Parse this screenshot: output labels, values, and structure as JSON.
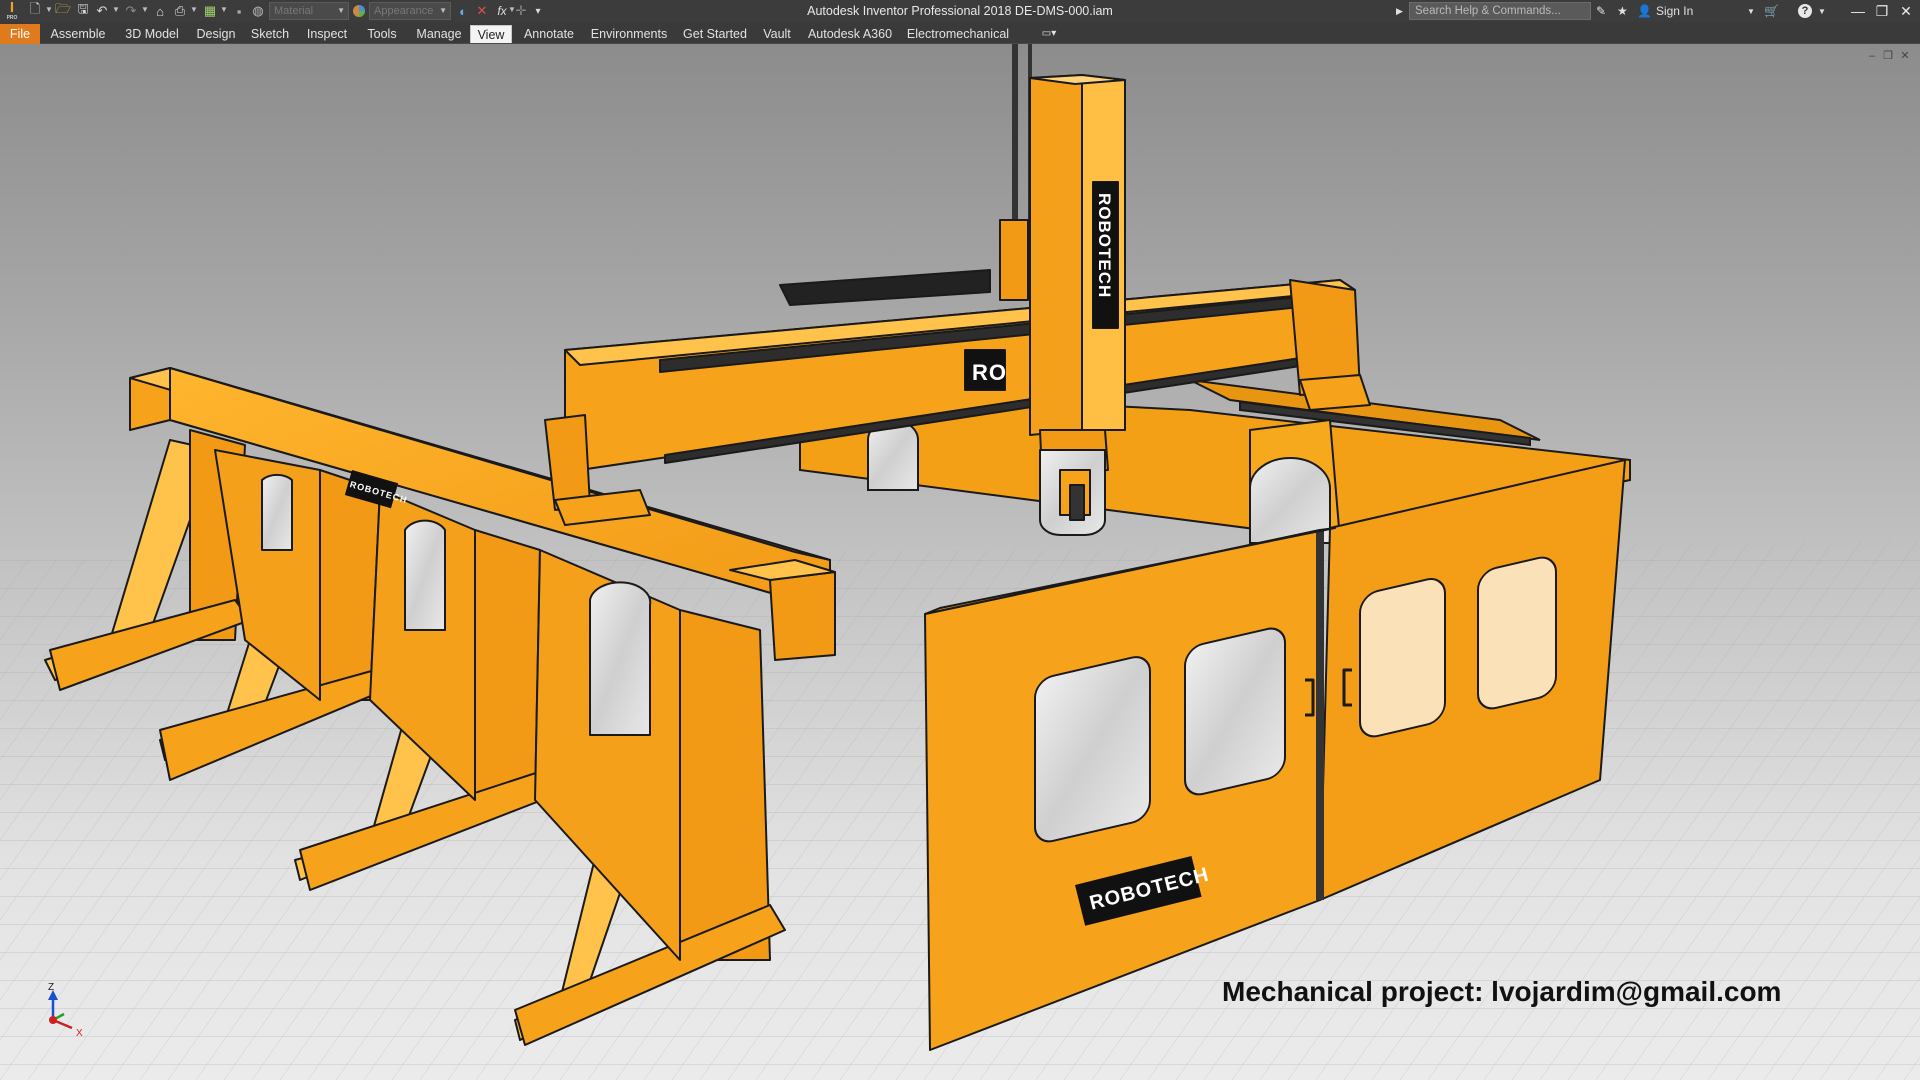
{
  "window": {
    "title": "Autodesk Inventor Professional 2018   DE-DMS-000.iam",
    "material_placeholder": "Material",
    "appearance_placeholder": "Appearance",
    "search_placeholder": "Search Help & Commands...",
    "sign_in": "Sign In",
    "app_logo": "I",
    "app_logo_sub": "PRO"
  },
  "quick_access": {
    "icons": [
      "new-icon",
      "open-icon",
      "save-icon",
      "undo-icon",
      "redo-icon",
      "home-icon",
      "print-icon",
      "select-icon",
      "color-icon",
      "material-icon",
      "appearance-icon",
      "clear-icon",
      "fx-icon",
      "move-icon",
      "customize-icon"
    ]
  },
  "ribbon": {
    "tabs": [
      {
        "label": "File"
      },
      {
        "label": "Assemble"
      },
      {
        "label": "3D Model"
      },
      {
        "label": "Design"
      },
      {
        "label": "Sketch"
      },
      {
        "label": "Inspect"
      },
      {
        "label": "Tools"
      },
      {
        "label": "Manage"
      },
      {
        "label": "View"
      },
      {
        "label": "Annotate"
      },
      {
        "label": "Environments"
      },
      {
        "label": "Get Started"
      },
      {
        "label": "Vault"
      },
      {
        "label": "Autodesk A360"
      },
      {
        "label": "Electromechanical"
      }
    ],
    "active_tab": "View"
  },
  "model": {
    "brand_labels": [
      "ROBOTECH",
      "ROBOTECH",
      "ROBOTECH",
      "RO"
    ],
    "colors": {
      "body": "#f7a21b",
      "body_light": "#ffc24a",
      "body_dark": "#d9820d",
      "outline": "#1a1a1a",
      "window": "#e4e4e4",
      "rail": "#333333"
    }
  },
  "axis_triad": {
    "z": "Z",
    "x": "X"
  },
  "watermark": "Mechanical project: lvojardim@gmail.com"
}
